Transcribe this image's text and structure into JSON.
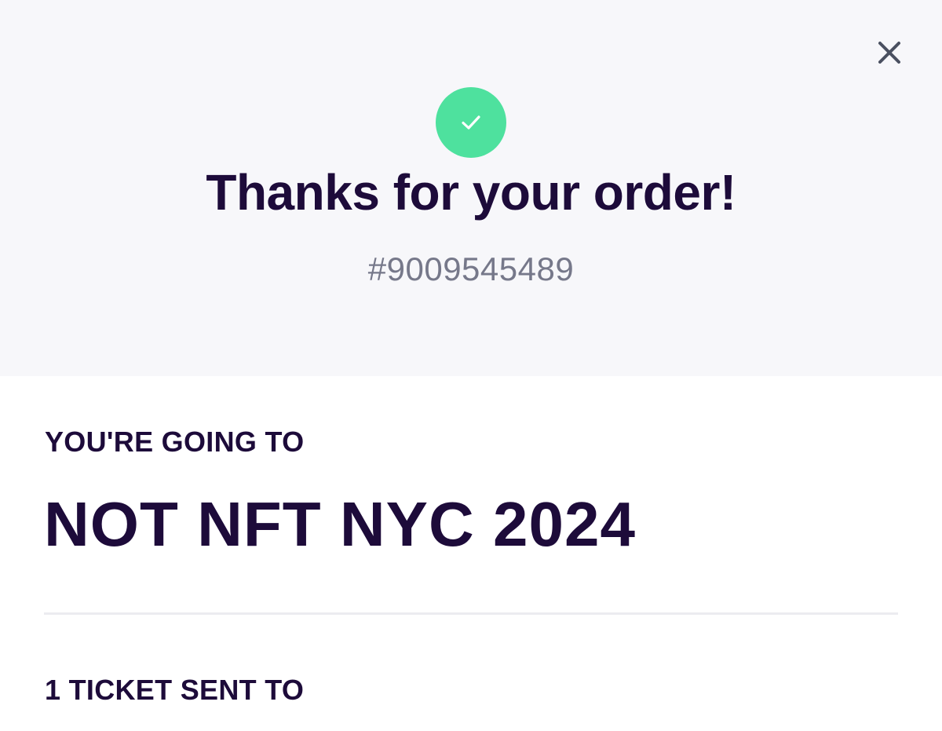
{
  "header": {
    "close_icon": "close-icon",
    "success_icon": "check-icon",
    "title": "Thanks for your order!",
    "order_number": "#9009545489"
  },
  "event": {
    "label": "YOU'RE GOING TO",
    "name": "NOT NFT NYC 2024"
  },
  "tickets": {
    "label": "1 TICKET SENT TO"
  },
  "colors": {
    "header_bg": "#f7f7fa",
    "primary_text": "#1d0b3a",
    "muted_text": "#76788a",
    "success": "#4ee19e",
    "close_icon": "#4a5060",
    "divider": "#ececf0"
  }
}
